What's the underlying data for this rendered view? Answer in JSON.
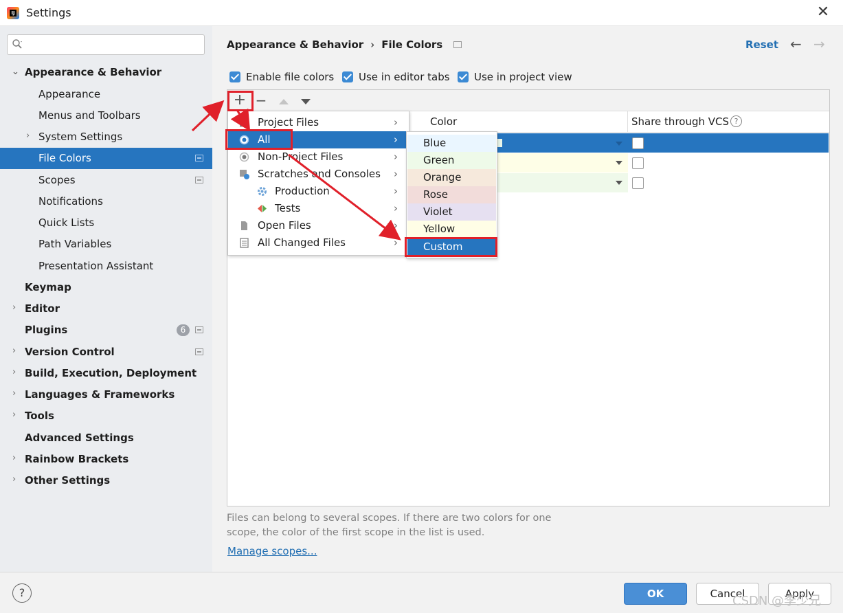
{
  "window": {
    "title": "Settings",
    "close_glyph": "✕"
  },
  "sidebar": {
    "search_placeholder": "",
    "items": [
      {
        "label": "Appearance & Behavior"
      },
      {
        "label": "Appearance"
      },
      {
        "label": "Menus and Toolbars"
      },
      {
        "label": "System Settings"
      },
      {
        "label": "File Colors"
      },
      {
        "label": "Scopes"
      },
      {
        "label": "Notifications"
      },
      {
        "label": "Quick Lists"
      },
      {
        "label": "Path Variables"
      },
      {
        "label": "Presentation Assistant"
      },
      {
        "label": "Keymap"
      },
      {
        "label": "Editor"
      },
      {
        "label": "Plugins",
        "badge": "6"
      },
      {
        "label": "Version Control"
      },
      {
        "label": "Build, Execution, Deployment"
      },
      {
        "label": "Languages & Frameworks"
      },
      {
        "label": "Tools"
      },
      {
        "label": "Advanced Settings"
      },
      {
        "label": "Rainbow Brackets"
      },
      {
        "label": "Other Settings"
      }
    ]
  },
  "breadcrumb": {
    "parent": "Appearance & Behavior",
    "sep": "›",
    "current": "File Colors"
  },
  "header": {
    "reset": "Reset",
    "back": "←",
    "forward": "→"
  },
  "options": [
    {
      "label": "Enable file colors",
      "checked": true
    },
    {
      "label": "Use in editor tabs",
      "checked": true
    },
    {
      "label": "Use in project view",
      "checked": true
    }
  ],
  "toolbar": {
    "add": "+",
    "remove": "−"
  },
  "table": {
    "col_color": "Color",
    "col_vcs": "Share through VCS",
    "help": "?"
  },
  "scope_menu": {
    "items": [
      {
        "label": "Project Files"
      },
      {
        "label": "All"
      },
      {
        "label": "Non-Project Files"
      },
      {
        "label": "Scratches and Consoles"
      },
      {
        "label": "Production"
      },
      {
        "label": "Tests"
      },
      {
        "label": "Open Files"
      },
      {
        "label": "All Changed Files"
      }
    ],
    "arrow": "›"
  },
  "color_menu": {
    "items": [
      {
        "label": "Blue",
        "bg": "#eaf6ff"
      },
      {
        "label": "Green",
        "bg": "#eefae9"
      },
      {
        "label": "Orange",
        "bg": "#f6e9dc"
      },
      {
        "label": "Rose",
        "bg": "#f2dcda"
      },
      {
        "label": "Violet",
        "bg": "#e6e0f1"
      },
      {
        "label": "Yellow",
        "bg": "#fffee6"
      },
      {
        "label": "Custom",
        "bg": "#2675bf"
      }
    ]
  },
  "hint": {
    "line1": "Files can belong to several scopes. If there are two colors for one",
    "line2": "scope, the color of the first scope in the list is used."
  },
  "manage_scopes": "Manage scopes...",
  "footer": {
    "help": "?",
    "ok": "OK",
    "cancel": "Cancel",
    "apply": "Apply"
  },
  "watermark": "CSDN @李少兄",
  "colors": {
    "accent": "#2675bf",
    "annotation": "#e0202a",
    "link": "#2470b3"
  }
}
